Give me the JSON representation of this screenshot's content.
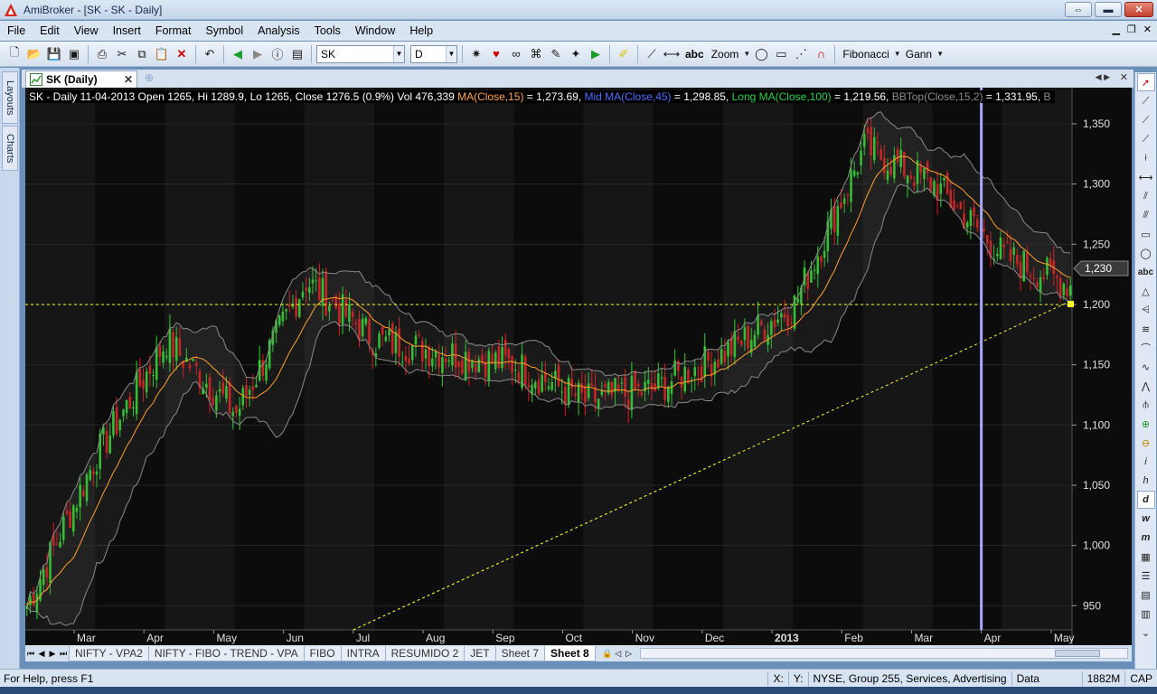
{
  "window": {
    "title": "AmiBroker - [SK - SK - Daily]",
    "restore_label": "⇔",
    "minimize_label": "▬",
    "close_label": "✕"
  },
  "menu": [
    "File",
    "Edit",
    "View",
    "Insert",
    "Format",
    "Symbol",
    "Analysis",
    "Tools",
    "Window",
    "Help"
  ],
  "toolbar": {
    "symbol_value": "SK",
    "interval_value": "D",
    "zoom_label": "Zoom",
    "fibonacci_label": "Fibonacci",
    "gann_label": "Gann",
    "abc_label": "abc"
  },
  "left_tabs": [
    "Layouts",
    "Charts"
  ],
  "chart_tab": {
    "label": "SK (Daily)"
  },
  "info": {
    "main": "SK - Daily 11-04-2013 Open 1265, Hi 1289.9, Lo 1265, Close 1276.5 (0.9%) Vol 476,339 ",
    "ma15_label": "MA(Close,15)",
    "ma15_value": " = 1,273.69, ",
    "mid_label": "Mid MA(Close,45)",
    "mid_value": " = 1,298.85, ",
    "long_label": "Long MA(Close,100)",
    "long_value": " = 1,219.56, ",
    "bbtop_label": "BBTop(Close,15,2)",
    "bbtop_value": " = 1,331.95, ",
    "tail": "B"
  },
  "chart_data": {
    "type": "candlestick",
    "symbol": "SK",
    "interval": "Daily",
    "ylim": [
      930,
      1380
    ],
    "y_ticks": [
      950,
      1000,
      1050,
      1100,
      1150,
      1200,
      1250,
      1300,
      1350
    ],
    "y_tick_labels": [
      "950",
      "1,000",
      "1,050",
      "1,100",
      "1,150",
      "1,200",
      "1,250",
      "1,300",
      "1,350"
    ],
    "x_labels": [
      "Mar",
      "Apr",
      "May",
      "Jun",
      "Jul",
      "Aug",
      "Sep",
      "Oct",
      "Nov",
      "Dec",
      "2013",
      "Feb",
      "Mar",
      "Apr",
      "May"
    ],
    "price_marker": {
      "value": 1230,
      "label": "1,230"
    },
    "horizontal_line": {
      "value": 1200
    },
    "trendline": {
      "from": [
        "Jul",
        930
      ],
      "to": [
        "May",
        1202
      ]
    },
    "monthly_close_approx": [
      {
        "month": "Mar",
        "close": 1075
      },
      {
        "month": "Apr",
        "close": 1170
      },
      {
        "month": "May",
        "close": 1110
      },
      {
        "month": "Jun",
        "close": 1220
      },
      {
        "month": "Jul",
        "close": 1170
      },
      {
        "month": "Aug",
        "close": 1160
      },
      {
        "month": "Sep",
        "close": 1150
      },
      {
        "month": "Oct",
        "close": 1120
      },
      {
        "month": "Nov",
        "close": 1130
      },
      {
        "month": "Dec",
        "close": 1160
      },
      {
        "month": "2013",
        "close": 1200
      },
      {
        "month": "Feb",
        "close": 1330
      },
      {
        "month": "Mar",
        "close": 1300
      },
      {
        "month": "Apr",
        "close": 1240
      },
      {
        "month": "May",
        "close": 1215
      }
    ]
  },
  "sheets": [
    "NIFTY - VPA2",
    "NIFTY - FIBO - TREND - VPA",
    "FIBO",
    "INTRA",
    "RESUMIDO 2",
    "JET",
    "Sheet 7",
    "Sheet 8"
  ],
  "active_sheet": "Sheet 8",
  "status": {
    "help": "For Help, press F1",
    "x_label": "X:",
    "y_label": "Y:",
    "market": "NYSE, Group 255, Services, Advertising",
    "data": "Data",
    "memory": "1882M",
    "caps": "CAP"
  },
  "colors": {
    "up_candle": "#2fd32f",
    "down_candle": "#e01a1a",
    "ma_short": "#ffa030",
    "bollinger": "#8a8a8a",
    "hline": "#ffff30",
    "cursor_line": "#a8a8ff",
    "background": "#0c0c0c"
  }
}
